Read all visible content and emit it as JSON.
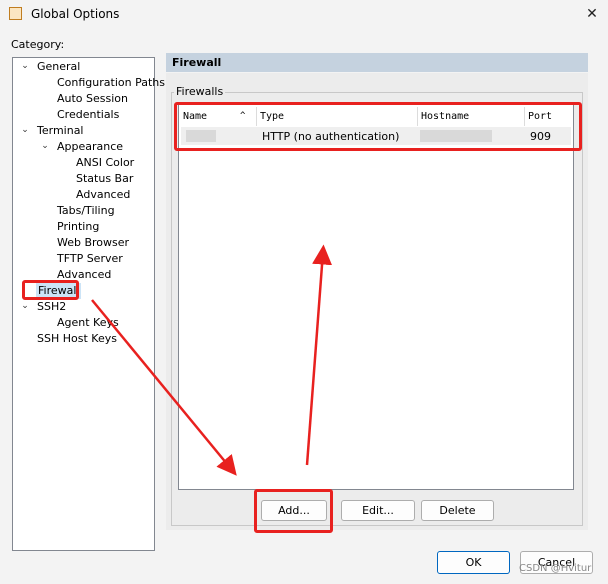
{
  "window": {
    "title": "Global Options",
    "close_glyph": "✕"
  },
  "category_label": "Category:",
  "tree": [
    {
      "label": "General",
      "toggle": "⌄"
    },
    {
      "label": "Configuration Paths"
    },
    {
      "label": "Auto Session"
    },
    {
      "label": "Credentials"
    },
    {
      "label": "Terminal",
      "toggle": "⌄"
    },
    {
      "label": "Appearance",
      "toggle": "⌄"
    },
    {
      "label": "ANSI Color"
    },
    {
      "label": "Status Bar"
    },
    {
      "label": "Advanced"
    },
    {
      "label": "Tabs/Tiling"
    },
    {
      "label": "Printing"
    },
    {
      "label": "Web Browser"
    },
    {
      "label": "TFTP Server"
    },
    {
      "label": "Advanced"
    },
    {
      "label": "Firewall",
      "selected": true
    },
    {
      "label": "SSH2",
      "toggle": "⌄"
    },
    {
      "label": "Agent Keys"
    },
    {
      "label": "SSH Host Keys"
    }
  ],
  "panel": {
    "header": "Firewall",
    "group_title": "Firewalls",
    "columns": [
      "Name",
      "Type",
      "Hostname",
      "Port"
    ],
    "sort_glyph": "^",
    "rows": [
      {
        "type": "HTTP (no authentication)",
        "port": "909"
      }
    ],
    "buttons": {
      "add": "Add...",
      "edit": "Edit...",
      "delete": "Delete"
    }
  },
  "footer": {
    "ok": "OK",
    "cancel": "Cancel"
  },
  "watermark": "CSDN @Hvitur",
  "colors": {
    "annotation": "#e8211f",
    "header_bar": "#c5d2df",
    "selection": "#cce4f7"
  }
}
